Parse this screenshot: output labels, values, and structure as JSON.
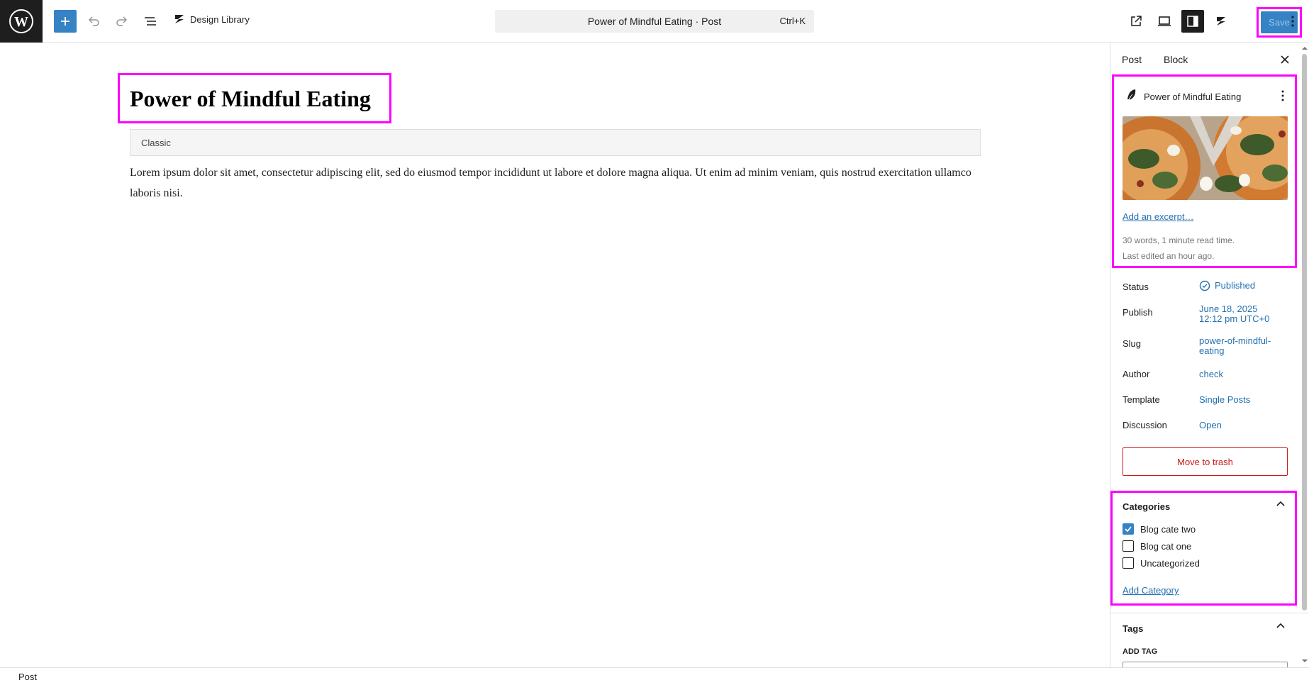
{
  "toolbar": {
    "design_library_label": "Design Library",
    "command_title": "Power of Mindful Eating · Post",
    "command_shortcut": "Ctrl+K",
    "save_label": "Save"
  },
  "editor": {
    "post_title": "Power of Mindful Eating",
    "classic_label": "Classic",
    "body_text": "Lorem ipsum dolor sit amet, consectetur adipiscing elit, sed do eiusmod tempor incididunt ut labore et dolore magna aliqua. Ut enim ad minim veniam, quis nostrud exercitation ullamco laboris nisi."
  },
  "sidebar": {
    "tabs": [
      "Post",
      "Block"
    ],
    "summary": {
      "title": "Power of Mindful Eating",
      "excerpt_link": "Add an excerpt…",
      "word_count": "30 words, 1 minute read time.",
      "last_edited": "Last edited an hour ago."
    },
    "rows": {
      "status": {
        "label": "Status",
        "value": "Published"
      },
      "publish": {
        "label": "Publish",
        "value_line1": "June 18, 2025",
        "value_line2": "12:12 pm UTC+0"
      },
      "slug": {
        "label": "Slug",
        "value_line1": "power-of-mindful-",
        "value_line2": "eating"
      },
      "author": {
        "label": "Author",
        "value": "check"
      },
      "template": {
        "label": "Template",
        "value": "Single Posts"
      },
      "discussion": {
        "label": "Discussion",
        "value": "Open"
      }
    },
    "trash_label": "Move to trash",
    "categories": {
      "title": "Categories",
      "items": [
        {
          "label": "Blog cate two",
          "checked": true
        },
        {
          "label": "Blog cat one",
          "checked": false
        },
        {
          "label": "Uncategorized",
          "checked": false
        }
      ],
      "add_link": "Add Category"
    },
    "tags": {
      "title": "Tags",
      "add_label": "ADD TAG"
    }
  },
  "footer": {
    "breadcrumb": "Post"
  },
  "colors": {
    "accent": "#3582c4",
    "link": "#2271b1",
    "highlight": "#ff00ff",
    "danger": "#cc1818"
  }
}
